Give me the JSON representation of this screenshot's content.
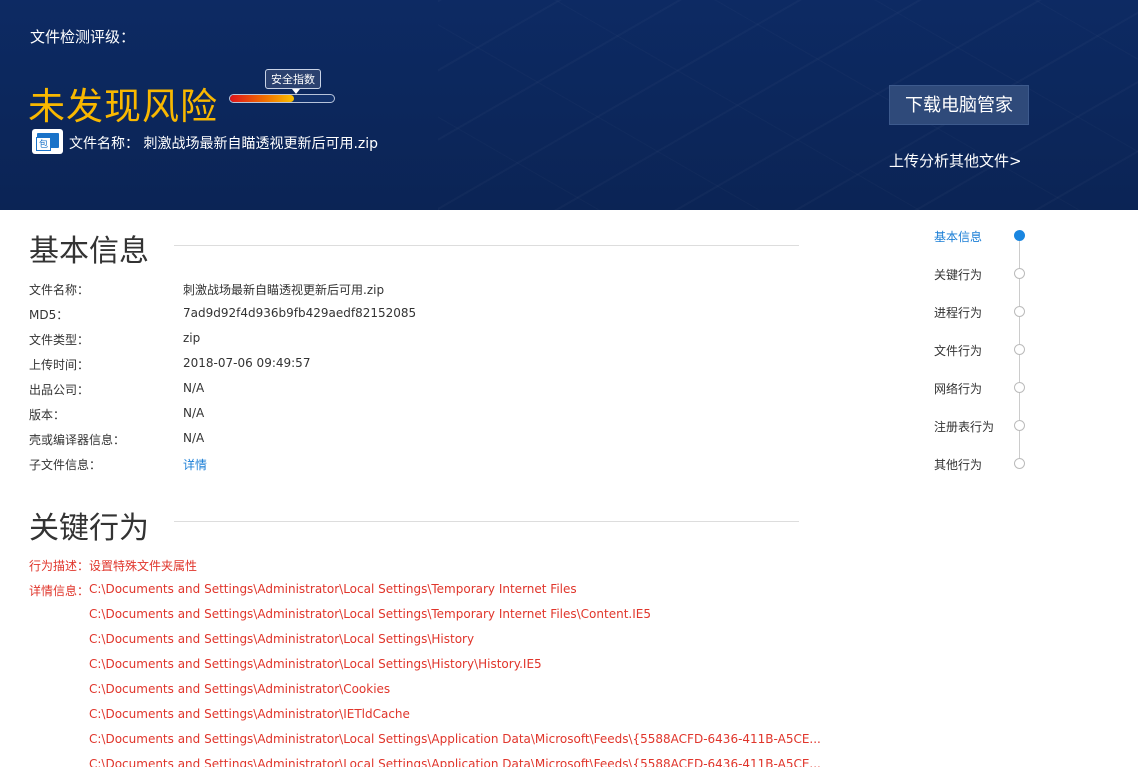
{
  "header": {
    "rating_title": "文件检测评级：",
    "verdict": "未发现风险",
    "safety_label": "安全指数",
    "safety_level": 0.62,
    "file_name_line": "文件名称： 刺激战场最新自瞄透视更新后可用.zip",
    "download_button": "下载电脑管家",
    "upload_link": "上传分析其他文件>",
    "icon_text": "包"
  },
  "basic_info": {
    "title": "基本信息",
    "rows": [
      {
        "label": "文件名称：",
        "value": "刺激战场最新自瞄透视更新后可用.zip"
      },
      {
        "label": "MD5：",
        "value": "7ad9d92f4d936b9fb429aedf82152085"
      },
      {
        "label": "文件类型：",
        "value": "zip"
      },
      {
        "label": "上传时间：",
        "value": "2018-07-06 09:49:57"
      },
      {
        "label": "出品公司：",
        "value": "N/A"
      },
      {
        "label": "版本：",
        "value": "N/A"
      },
      {
        "label": "壳或编译器信息：",
        "value": "N/A"
      },
      {
        "label": "子文件信息：",
        "value": "详情"
      }
    ]
  },
  "key_behavior": {
    "title": "关键行为",
    "desc_label": "行为描述：",
    "desc_value": "设置特殊文件夹属性",
    "detail_label": "详情信息：",
    "paths": [
      "C:\\Documents and Settings\\Administrator\\Local Settings\\Temporary Internet Files",
      "C:\\Documents and Settings\\Administrator\\Local Settings\\Temporary Internet Files\\Content.IE5",
      "C:\\Documents and Settings\\Administrator\\Local Settings\\History",
      "C:\\Documents and Settings\\Administrator\\Local Settings\\History\\History.IE5",
      "C:\\Documents and Settings\\Administrator\\Cookies",
      "C:\\Documents and Settings\\Administrator\\IETldCache",
      "C:\\Documents and Settings\\Administrator\\Local Settings\\Application Data\\Microsoft\\Feeds\\{5588ACFD-6436-411B-A5CE...",
      "C:\\Documents and Settings\\Administrator\\Local Settings\\Application Data\\Microsoft\\Feeds\\{5588ACFD-6436-411B-A5CE..."
    ]
  },
  "side_nav": {
    "items": [
      "基本信息",
      "关键行为",
      "进程行为",
      "文件行为",
      "网络行为",
      "注册表行为",
      "其他行为"
    ],
    "active_index": 0
  }
}
